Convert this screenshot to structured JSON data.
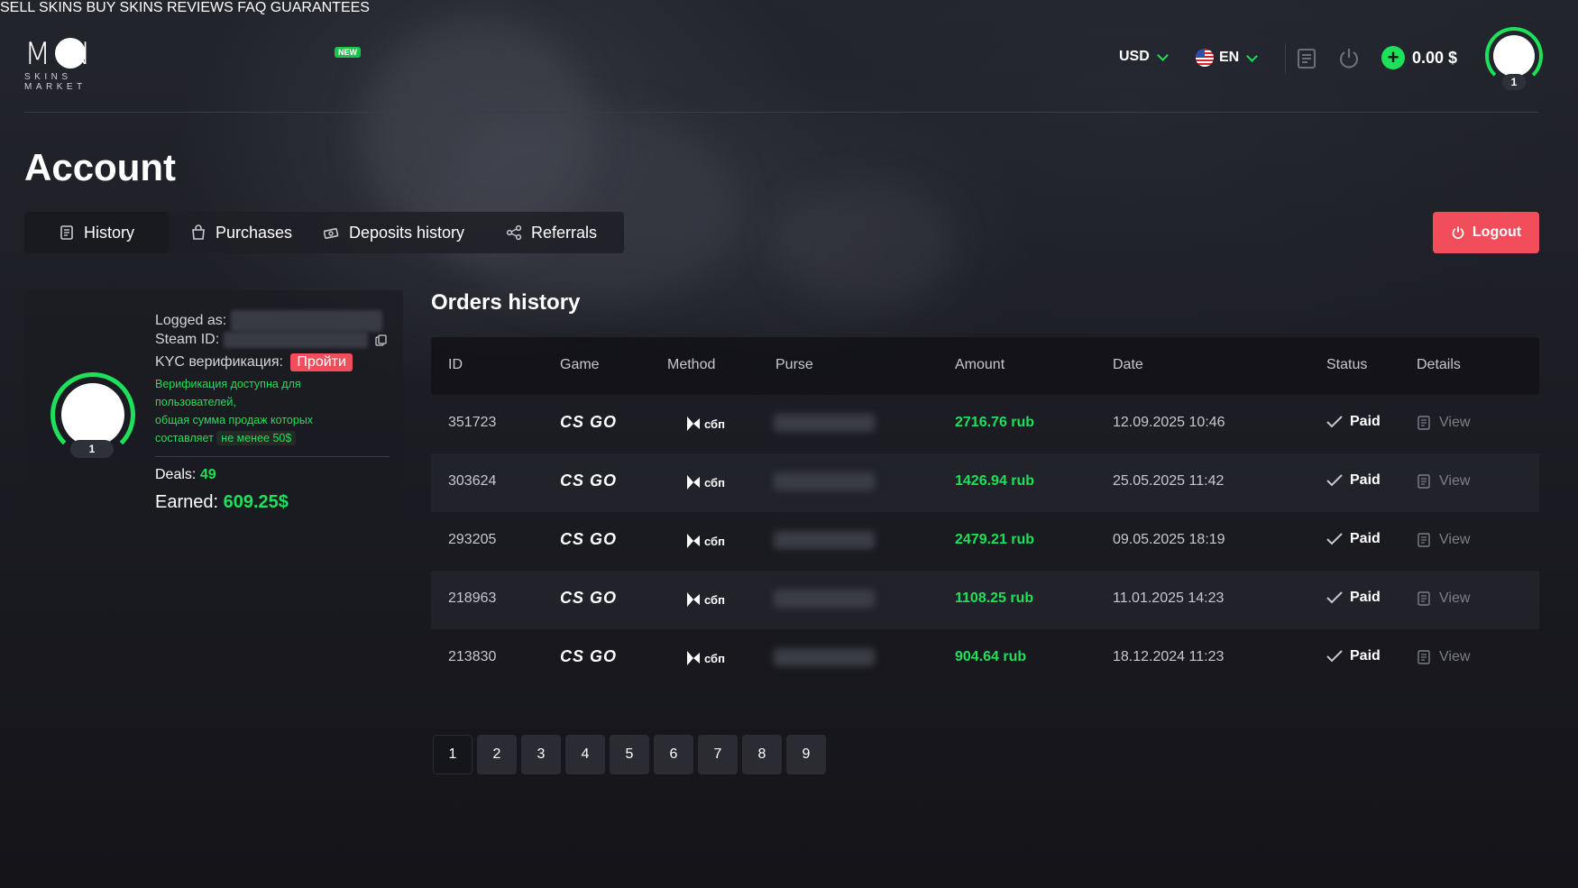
{
  "brand": {
    "logo_text": "M  N",
    "logo_sub": "SKINS MARKET"
  },
  "nav": {
    "sell": "SELL SKINS",
    "buy": "BUY SKINS",
    "buy_badge": "NEW",
    "reviews": "REVIEWS",
    "faq": "FAQ",
    "guarantees": "GUARANTEES"
  },
  "header": {
    "currency": "USD",
    "language": "EN",
    "balance": "0.00 $",
    "level": "1",
    "accent_color": "#1fe05a"
  },
  "page": {
    "title": "Account",
    "logout": "Logout"
  },
  "tabs": [
    {
      "label": "History",
      "icon": "document-icon"
    },
    {
      "label": "Purchases",
      "icon": "bag-icon"
    },
    {
      "label": "Deposits history",
      "icon": "cash-icon"
    },
    {
      "label": "Referrals",
      "icon": "share-icon"
    }
  ],
  "profile": {
    "logged_as_label": "Logged as:",
    "steam_id_label": "Steam ID:",
    "kyc_label": "KYC верификация:",
    "kyc_button": "Пройти",
    "kyc_note_1": "Верификация доступна для",
    "kyc_note_2": "пользователей,",
    "kyc_note_3": "общая сумма продаж которых",
    "kyc_note_4": "составляет",
    "kyc_note_pill": "не менее 50$",
    "deals_label": "Deals:",
    "deals_value": "49",
    "earned_label": "Earned:",
    "earned_value": "609.25$",
    "level": "1"
  },
  "orders": {
    "title": "Orders history",
    "columns": [
      "ID",
      "Game",
      "Method",
      "Purse",
      "Amount",
      "Date",
      "Status",
      "Details"
    ],
    "game_label": "CS GO",
    "method_label": "сбп",
    "rows": [
      {
        "id": "351723",
        "amount": "2716.76 rub",
        "date": "12.09.2025 10:46",
        "status": "Paid",
        "details": "View"
      },
      {
        "id": "303624",
        "amount": "1426.94 rub",
        "date": "25.05.2025 11:42",
        "status": "Paid",
        "details": "View"
      },
      {
        "id": "293205",
        "amount": "2479.21 rub",
        "date": "09.05.2025 18:19",
        "status": "Paid",
        "details": "View"
      },
      {
        "id": "218963",
        "amount": "1108.25 rub",
        "date": "11.01.2025 14:23",
        "status": "Paid",
        "details": "View"
      },
      {
        "id": "213830",
        "amount": "904.64 rub",
        "date": "18.12.2024 11:23",
        "status": "Paid",
        "details": "View"
      }
    ]
  },
  "pagination": {
    "pages": [
      "1",
      "2",
      "3",
      "4",
      "5",
      "6",
      "7",
      "8",
      "9"
    ],
    "current": "1"
  }
}
